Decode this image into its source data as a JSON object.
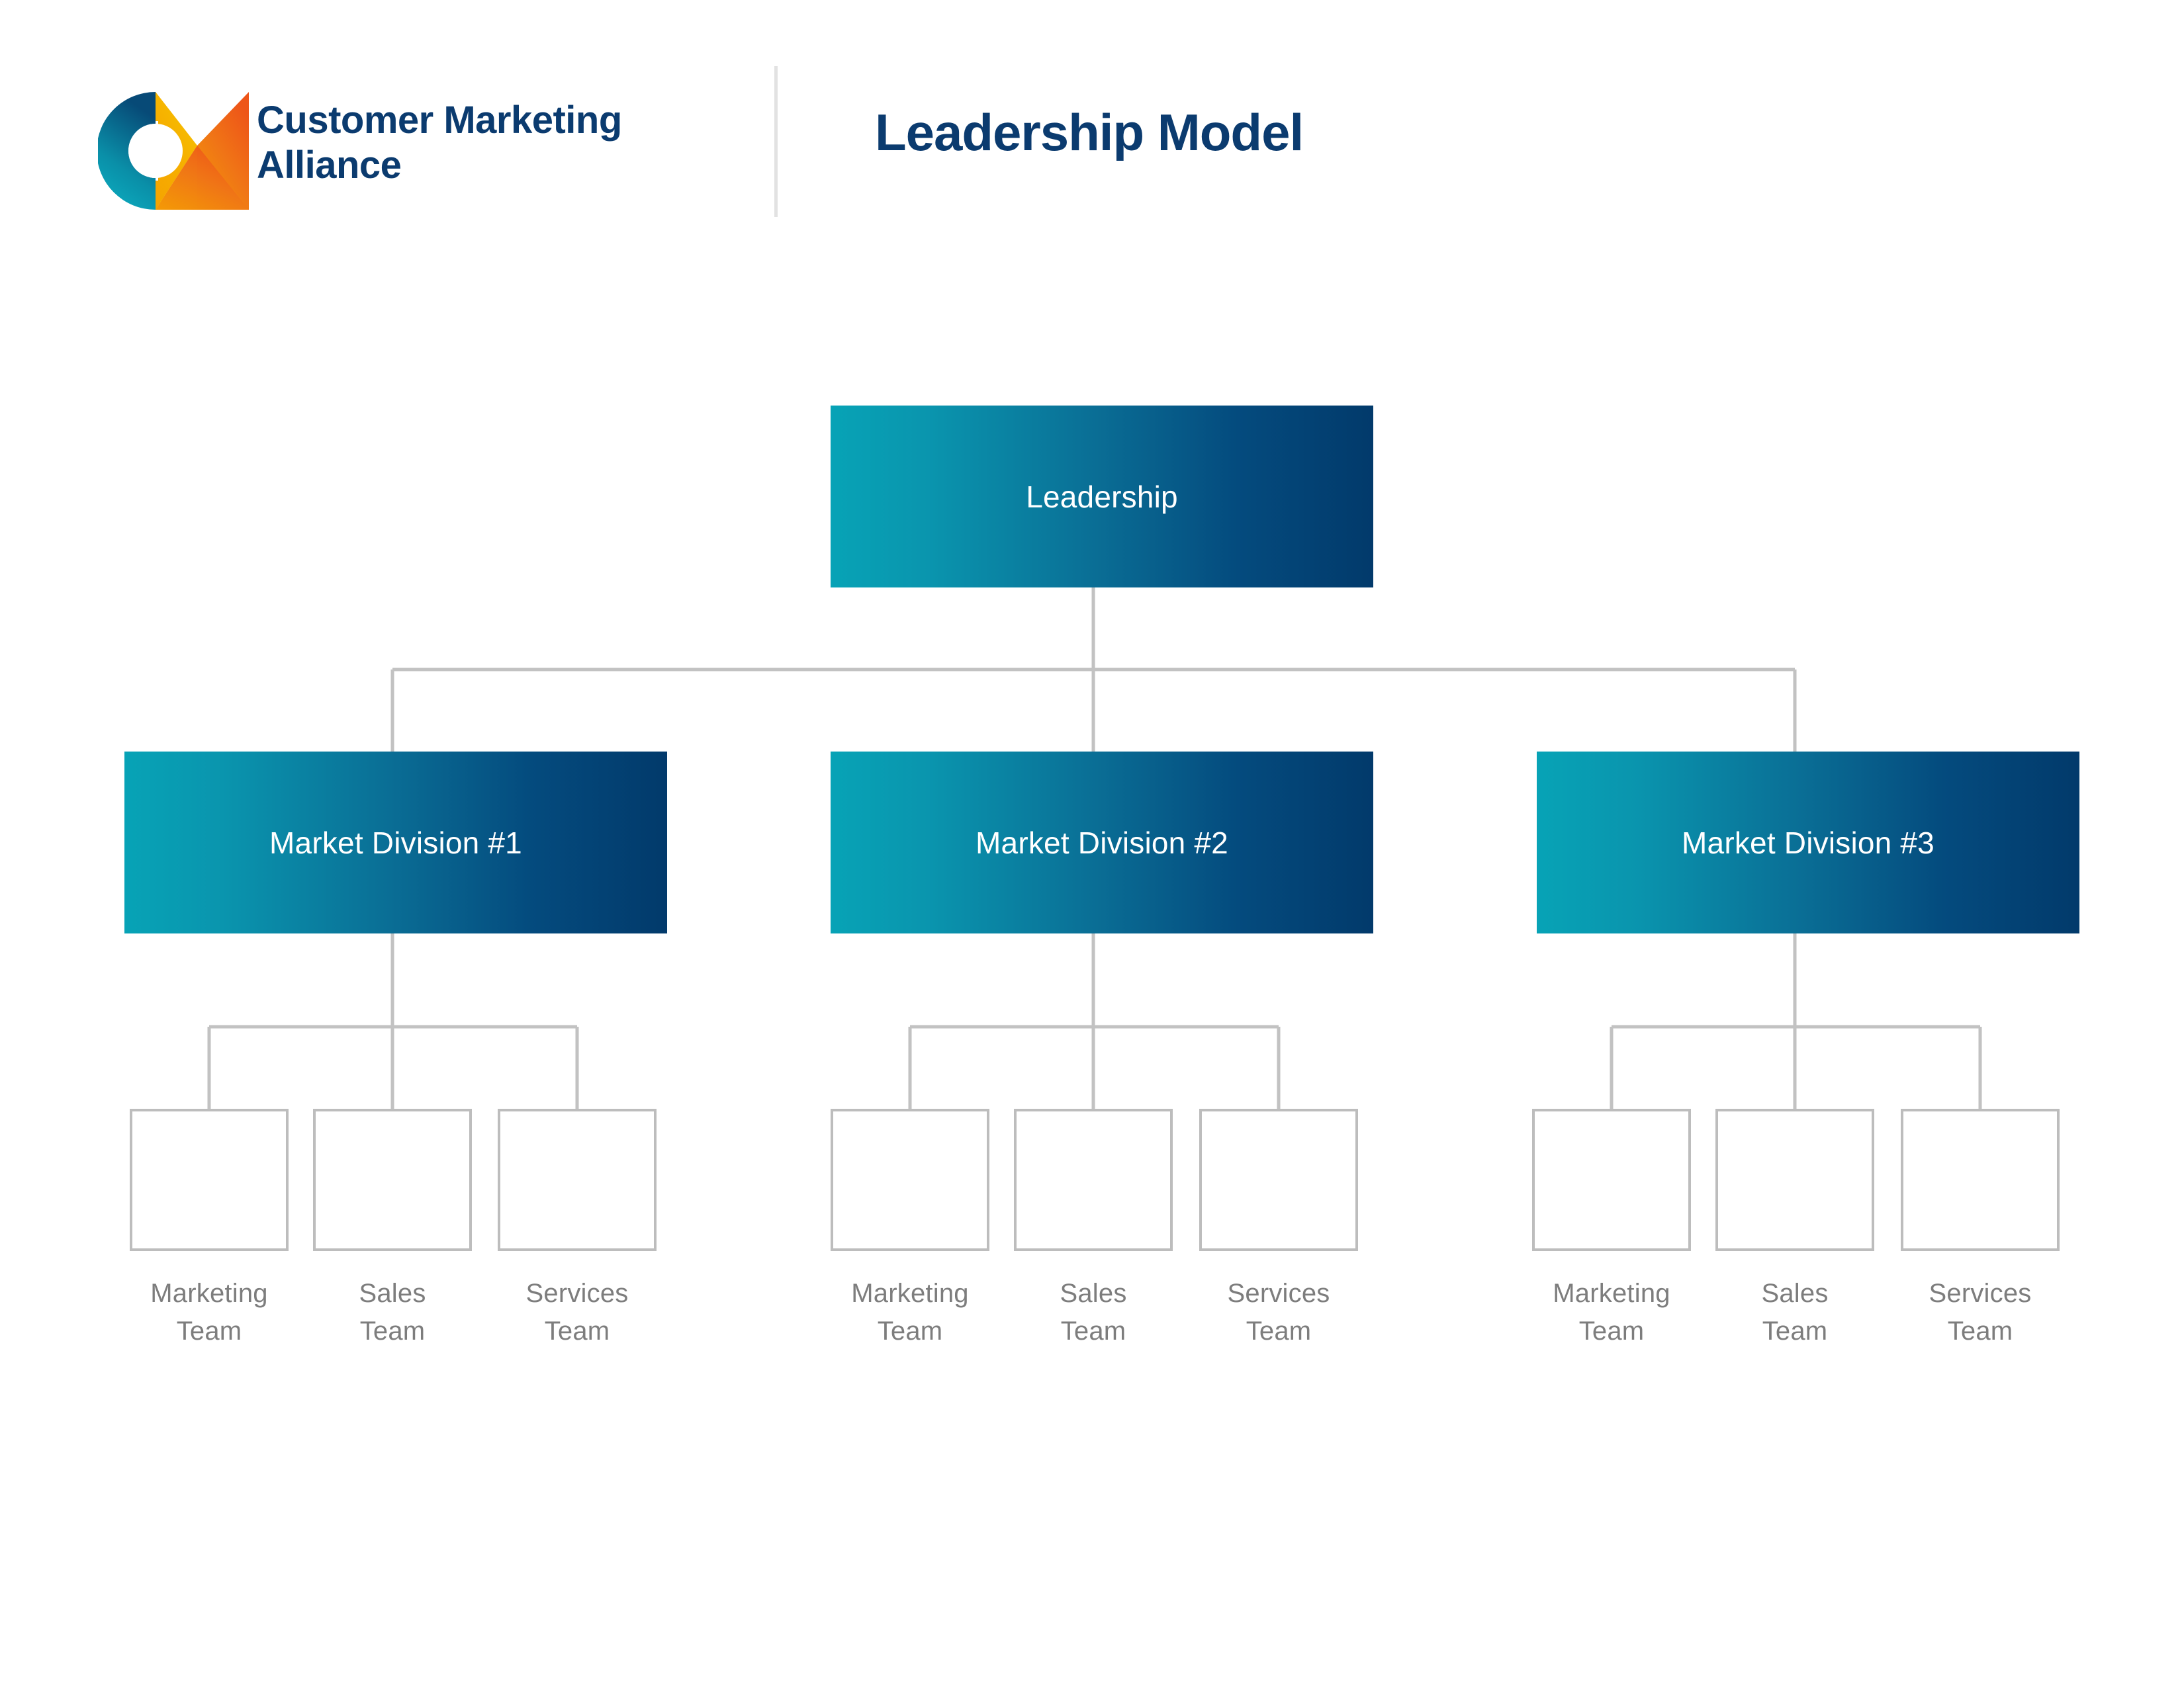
{
  "header": {
    "logo": {
      "icon_name": "cma-logo-mark",
      "line1": "Customer Marketing",
      "line2": "Alliance",
      "text_color": "#0b3b6f",
      "gradient_c_start": "#0aa8bd",
      "gradient_c_end": "#084a76",
      "gradient_m_start": "#f2a000",
      "gradient_m_end": "#ef5a14"
    },
    "divider_color": "#e2e2e2",
    "title": "Leadership Model",
    "title_color": "#0b3b6f"
  },
  "theme": {
    "node_gradient_start": "#07a3b6",
    "node_gradient_end": "#023a6b",
    "node_text_color": "#ffffff",
    "connector_color": "#c2c2c2",
    "leaf_border_color": "#bdbdbd",
    "leaf_label_color": "#7d7d7d",
    "background": "#ffffff"
  },
  "chart_data": {
    "type": "diagram",
    "diagram_type": "organizational-chart",
    "title": "Leadership Model",
    "root": "Leadership",
    "levels": 3,
    "nodes": [
      {
        "id": "leadership",
        "label": "Leadership",
        "level": 0,
        "parent": null,
        "style": "gradient"
      },
      {
        "id": "division-1",
        "label": "Market Division #1",
        "level": 1,
        "parent": "leadership",
        "style": "gradient"
      },
      {
        "id": "division-2",
        "label": "Market Division #2",
        "level": 1,
        "parent": "leadership",
        "style": "gradient"
      },
      {
        "id": "division-3",
        "label": "Market Division #3",
        "level": 1,
        "parent": "leadership",
        "style": "gradient"
      },
      {
        "id": "d1-marketing",
        "label": "Marketing Team",
        "level": 2,
        "parent": "division-1",
        "style": "outline"
      },
      {
        "id": "d1-sales",
        "label": "Sales Team",
        "level": 2,
        "parent": "division-1",
        "style": "outline"
      },
      {
        "id": "d1-services",
        "label": "Services Team",
        "level": 2,
        "parent": "division-1",
        "style": "outline"
      },
      {
        "id": "d2-marketing",
        "label": "Marketing Team",
        "level": 2,
        "parent": "division-2",
        "style": "outline"
      },
      {
        "id": "d2-sales",
        "label": "Sales Team",
        "level": 2,
        "parent": "division-2",
        "style": "outline"
      },
      {
        "id": "d2-services",
        "label": "Services Team",
        "level": 2,
        "parent": "division-2",
        "style": "outline"
      },
      {
        "id": "d3-marketing",
        "label": "Marketing Team",
        "level": 2,
        "parent": "division-3",
        "style": "outline"
      },
      {
        "id": "d3-sales",
        "label": "Sales Team",
        "level": 2,
        "parent": "division-3",
        "style": "outline"
      },
      {
        "id": "d3-services",
        "label": "Services Team",
        "level": 2,
        "parent": "division-3",
        "style": "outline"
      }
    ]
  },
  "chart": {
    "root": {
      "label": "Leadership"
    },
    "divisions": [
      {
        "label": "Market Division #1",
        "teams": [
          {
            "line1": "Marketing",
            "line2": "Team"
          },
          {
            "line1": "Sales",
            "line2": "Team"
          },
          {
            "line1": "Services",
            "line2": "Team"
          }
        ]
      },
      {
        "label": "Market Division #2",
        "teams": [
          {
            "line1": "Marketing",
            "line2": "Team"
          },
          {
            "line1": "Sales",
            "line2": "Team"
          },
          {
            "line1": "Services",
            "line2": "Team"
          }
        ]
      },
      {
        "label": "Market Division #3",
        "teams": [
          {
            "line1": "Marketing",
            "line2": "Team"
          },
          {
            "line1": "Sales",
            "line2": "Team"
          },
          {
            "line1": "Services",
            "line2": "Team"
          }
        ]
      }
    ]
  }
}
